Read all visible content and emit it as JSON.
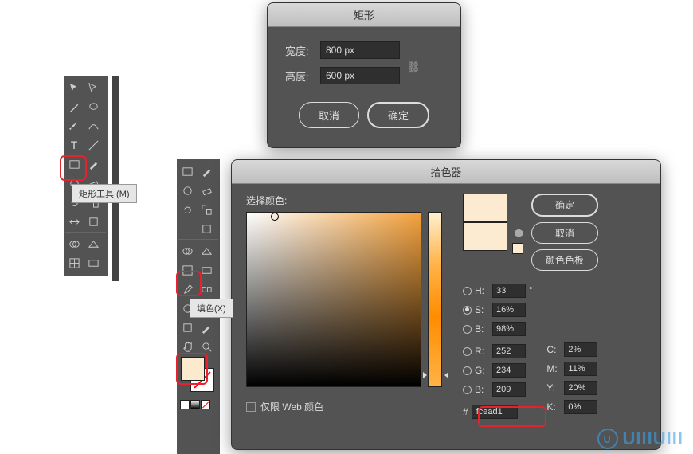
{
  "rect_dialog": {
    "title": "矩形",
    "width_label": "宽度:",
    "width_value": "800 px",
    "height_label": "高度:",
    "height_value": "600 px",
    "cancel": "取消",
    "ok": "确定"
  },
  "picker_dialog": {
    "title": "拾色器",
    "select_color": "选择颜色:",
    "web_only": "仅限 Web 颜色",
    "ok": "确定",
    "cancel": "取消",
    "swatches": "颜色色板",
    "new_color": "#fcead1",
    "old_color": "#fcead1",
    "hsb": {
      "h_label": "H:",
      "h": "33",
      "s_label": "S:",
      "s": "16%",
      "b_label": "B:",
      "b": "98%"
    },
    "rgb": {
      "r_label": "R:",
      "r": "252",
      "g_label": "G:",
      "g": "234",
      "b_label": "B:",
      "b": "209"
    },
    "cmyk": {
      "c_label": "C:",
      "c": "2%",
      "m_label": "M:",
      "m": "11%",
      "y_label": "Y:",
      "y": "20%",
      "k_label": "K:",
      "k": "0%"
    },
    "hex_label": "#",
    "hex": "fcead1"
  },
  "tooltips": {
    "rect_tool": "矩形工具 (M)",
    "fill": "填色(X)"
  },
  "deg_symbol": "°",
  "watermark": "U"
}
